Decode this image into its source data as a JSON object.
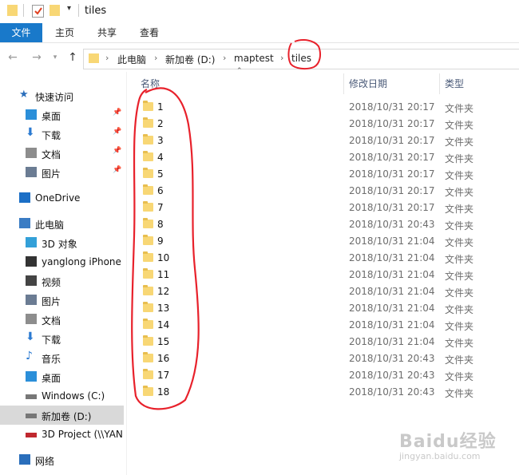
{
  "window": {
    "title": "tiles"
  },
  "ribbon": {
    "tabs": [
      "文件",
      "主页",
      "共享",
      "查看"
    ]
  },
  "address": {
    "crumbs": [
      "此电脑",
      "新加卷 (D:)",
      "maptest",
      "tiles"
    ]
  },
  "sidebar": {
    "items": [
      {
        "label": "快速访问",
        "icon": "star-icon",
        "pinned": false
      },
      {
        "label": "桌面",
        "icon": "desktop-icon",
        "pinned": true
      },
      {
        "label": "下载",
        "icon": "download-icon",
        "pinned": true
      },
      {
        "label": "文档",
        "icon": "document-icon",
        "pinned": true
      },
      {
        "label": "图片",
        "icon": "picture-icon",
        "pinned": true
      },
      {
        "label": "OneDrive",
        "icon": "cloud-icon",
        "pinned": false
      },
      {
        "label": "此电脑",
        "icon": "computer-icon",
        "pinned": false
      },
      {
        "label": "3D 对象",
        "icon": "cube-icon",
        "pinned": false
      },
      {
        "label": "yanglong iPhone",
        "icon": "phone-icon",
        "pinned": false
      },
      {
        "label": "视频",
        "icon": "video-icon",
        "pinned": false
      },
      {
        "label": "图片",
        "icon": "picture-icon",
        "pinned": false
      },
      {
        "label": "文档",
        "icon": "document-icon",
        "pinned": false
      },
      {
        "label": "下载",
        "icon": "download-icon",
        "pinned": false
      },
      {
        "label": "音乐",
        "icon": "music-icon",
        "pinned": false
      },
      {
        "label": "桌面",
        "icon": "desktop-icon",
        "pinned": false
      },
      {
        "label": "Windows (C:)",
        "icon": "drive-icon",
        "pinned": false
      },
      {
        "label": "新加卷 (D:)",
        "icon": "drive-icon",
        "pinned": false,
        "selected": true
      },
      {
        "label": "3D Project (\\\\YAN",
        "icon": "network-drive-icon",
        "pinned": false
      },
      {
        "label": "网络",
        "icon": "network-icon",
        "pinned": false
      }
    ]
  },
  "columns": {
    "name": "名称",
    "date": "修改日期",
    "type": "类型"
  },
  "files": [
    {
      "name": "1",
      "date": "2018/10/31 20:17",
      "type": "文件夹"
    },
    {
      "name": "2",
      "date": "2018/10/31 20:17",
      "type": "文件夹"
    },
    {
      "name": "3",
      "date": "2018/10/31 20:17",
      "type": "文件夹"
    },
    {
      "name": "4",
      "date": "2018/10/31 20:17",
      "type": "文件夹"
    },
    {
      "name": "5",
      "date": "2018/10/31 20:17",
      "type": "文件夹"
    },
    {
      "name": "6",
      "date": "2018/10/31 20:17",
      "type": "文件夹"
    },
    {
      "name": "7",
      "date": "2018/10/31 20:17",
      "type": "文件夹"
    },
    {
      "name": "8",
      "date": "2018/10/31 20:43",
      "type": "文件夹"
    },
    {
      "name": "9",
      "date": "2018/10/31 21:04",
      "type": "文件夹"
    },
    {
      "name": "10",
      "date": "2018/10/31 21:04",
      "type": "文件夹"
    },
    {
      "name": "11",
      "date": "2018/10/31 21:04",
      "type": "文件夹"
    },
    {
      "name": "12",
      "date": "2018/10/31 21:04",
      "type": "文件夹"
    },
    {
      "name": "13",
      "date": "2018/10/31 21:04",
      "type": "文件夹"
    },
    {
      "name": "14",
      "date": "2018/10/31 21:04",
      "type": "文件夹"
    },
    {
      "name": "15",
      "date": "2018/10/31 21:04",
      "type": "文件夹"
    },
    {
      "name": "16",
      "date": "2018/10/31 20:43",
      "type": "文件夹"
    },
    {
      "name": "17",
      "date": "2018/10/31 20:43",
      "type": "文件夹"
    },
    {
      "name": "18",
      "date": "2018/10/31 20:43",
      "type": "文件夹"
    }
  ],
  "watermark": {
    "logo_text": "Baidu经验",
    "url": "jingyan.baidu.com"
  },
  "colors": {
    "accent": "#1979ca",
    "annotation": "#e8212b",
    "folder": "#f8d775"
  }
}
